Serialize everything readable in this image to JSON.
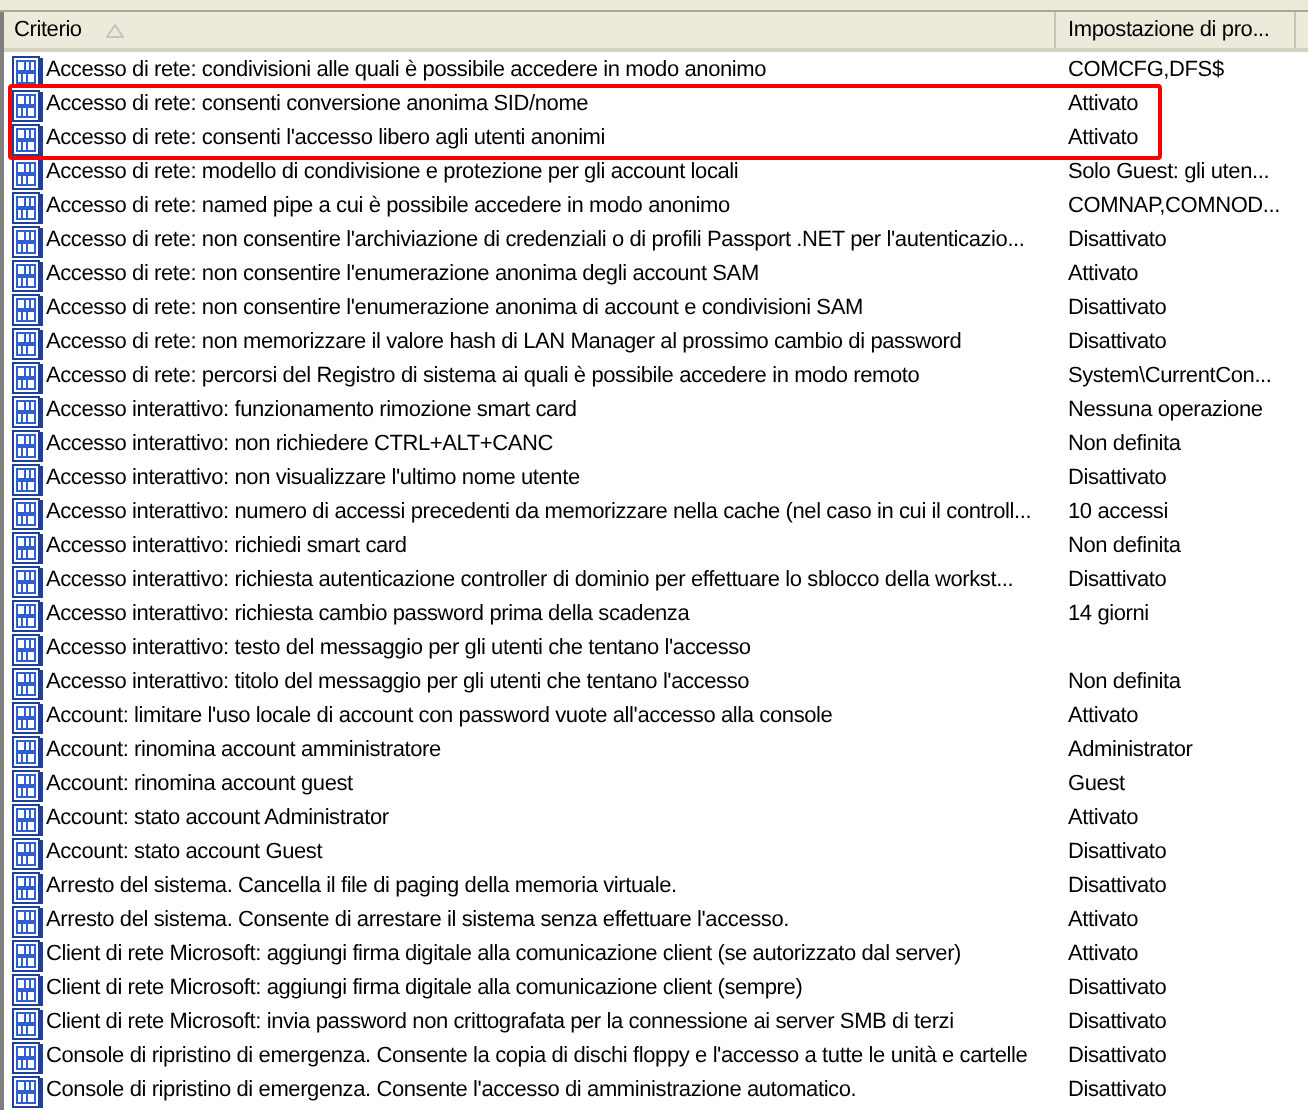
{
  "columns": [
    {
      "label": "Criterio",
      "sorted": true
    },
    {
      "label": "Impostazione di pro..."
    }
  ],
  "rows": [
    {
      "policy": "Accesso di rete: condivisioni alle quali è possibile accedere in modo anonimo",
      "setting": "COMCFG,DFS$",
      "highlighted": false
    },
    {
      "policy": "Accesso di rete: consenti conversione anonima SID/nome",
      "setting": "Attivato",
      "highlighted": true
    },
    {
      "policy": "Accesso di rete: consenti l'accesso libero agli utenti anonimi",
      "setting": "Attivato",
      "highlighted": true
    },
    {
      "policy": "Accesso di rete: modello di condivisione e protezione per gli account locali",
      "setting": "Solo Guest: gli uten...",
      "highlighted": false
    },
    {
      "policy": "Accesso di rete: named pipe a cui è possibile accedere in modo anonimo",
      "setting": "COMNAP,COMNOD...",
      "highlighted": false
    },
    {
      "policy": "Accesso di rete: non consentire l'archiviazione di credenziali o di profili Passport .NET per l'autenticazio...",
      "setting": "Disattivato",
      "highlighted": false
    },
    {
      "policy": "Accesso di rete: non consentire l'enumerazione anonima degli account SAM",
      "setting": "Attivato",
      "highlighted": false
    },
    {
      "policy": "Accesso di rete: non consentire l'enumerazione anonima di account e condivisioni SAM",
      "setting": "Disattivato",
      "highlighted": false
    },
    {
      "policy": "Accesso di rete: non memorizzare il valore hash di LAN Manager al prossimo cambio di password",
      "setting": "Disattivato",
      "highlighted": false
    },
    {
      "policy": "Accesso di rete: percorsi del Registro di sistema ai quali è possibile accedere in modo remoto",
      "setting": "System\\CurrentCon...",
      "highlighted": false
    },
    {
      "policy": "Accesso interattivo: funzionamento rimozione smart card",
      "setting": "Nessuna operazione",
      "highlighted": false
    },
    {
      "policy": "Accesso interattivo: non richiedere CTRL+ALT+CANC",
      "setting": "Non definita",
      "highlighted": false
    },
    {
      "policy": "Accesso interattivo: non visualizzare l'ultimo nome utente",
      "setting": "Disattivato",
      "highlighted": false
    },
    {
      "policy": "Accesso interattivo: numero di accessi precedenti da memorizzare nella cache (nel caso in cui il controll...",
      "setting": "10 accessi",
      "highlighted": false
    },
    {
      "policy": "Accesso interattivo: richiedi smart card",
      "setting": "Non definita",
      "highlighted": false
    },
    {
      "policy": "Accesso interattivo: richiesta autenticazione controller di dominio per effettuare lo sblocco della workst...",
      "setting": "Disattivato",
      "highlighted": false
    },
    {
      "policy": "Accesso interattivo: richiesta cambio password prima della scadenza",
      "setting": "14 giorni",
      "highlighted": false
    },
    {
      "policy": "Accesso interattivo: testo del messaggio per gli utenti che tentano l'accesso",
      "highlighted": false
    },
    {
      "policy": "Accesso interattivo: titolo del messaggio per gli utenti che tentano l'accesso",
      "setting": "Non definita",
      "highlighted": false
    },
    {
      "policy": "Account: limitare l'uso locale di account con password vuote all'accesso alla console",
      "setting": "Attivato",
      "highlighted": false
    },
    {
      "policy": "Account: rinomina account amministratore",
      "setting": "Administrator",
      "highlighted": false
    },
    {
      "policy": "Account: rinomina account guest",
      "setting": "Guest",
      "highlighted": false
    },
    {
      "policy": "Account: stato account Administrator",
      "setting": "Attivato",
      "highlighted": false
    },
    {
      "policy": "Account: stato account Guest",
      "setting": "Disattivato",
      "highlighted": false
    },
    {
      "policy": "Arresto del sistema. Cancella il file di paging della memoria virtuale.",
      "setting": "Disattivato",
      "highlighted": false
    },
    {
      "policy": "Arresto del sistema. Consente di arrestare il sistema senza effettuare l'accesso.",
      "setting": "Attivato",
      "highlighted": false
    },
    {
      "policy": "Client di rete Microsoft: aggiungi firma digitale alla comunicazione client (se autorizzato dal server)",
      "setting": "Attivato",
      "highlighted": false
    },
    {
      "policy": "Client di rete Microsoft: aggiungi firma digitale alla comunicazione client (sempre)",
      "setting": "Disattivato",
      "highlighted": false
    },
    {
      "policy": "Client di rete Microsoft: invia password non crittografata per la connessione ai server SMB di terzi",
      "setting": "Disattivato",
      "highlighted": false
    },
    {
      "policy": "Console di ripristino di emergenza. Consente la copia di dischi floppy e l'accesso a tutte le unità e cartelle",
      "setting": "Disattivato",
      "highlighted": false
    },
    {
      "policy": "Console di ripristino di emergenza. Consente l'accesso di amministrazione automatico.",
      "setting": "Disattivato",
      "highlighted": false
    }
  ]
}
